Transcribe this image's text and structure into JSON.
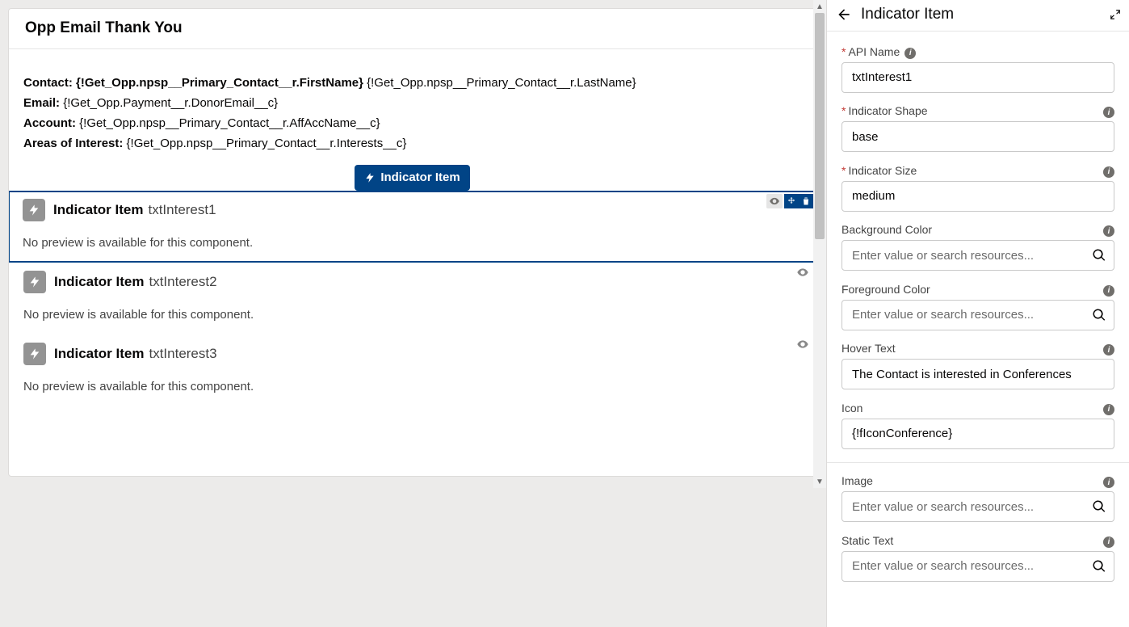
{
  "canvas": {
    "card_title": "Opp Email Thank You",
    "rows": [
      {
        "label": "Contact:",
        "value": "{!Get_Opp.npsp__Primary_Contact__r.FirstName} ",
        "value2": "{!Get_Opp.npsp__Primary_Contact__r.LastName}"
      },
      {
        "label": "Email:",
        "value": "{!Get_Opp.Payment__r.DonorEmail__c}"
      },
      {
        "label": "Account:",
        "value": "{!Get_Opp.npsp__Primary_Contact__r.AffAccName__c}"
      },
      {
        "label": "Areas of Interest:",
        "value": "{!Get_Opp.npsp__Primary_Contact__r.Interests__c}"
      }
    ],
    "badge_label": "Indicator Item",
    "indicators": [
      {
        "title": "Indicator Item",
        "sub": "txtInterest1",
        "msg": "No preview is available for this component.",
        "selected": true
      },
      {
        "title": "Indicator Item",
        "sub": "txtInterest2",
        "msg": "No preview is available for this component.",
        "selected": false
      },
      {
        "title": "Indicator Item",
        "sub": "txtInterest3",
        "msg": "No preview is available for this component.",
        "selected": false
      }
    ]
  },
  "panel": {
    "title": "Indicator Item",
    "fields": {
      "api_name": {
        "label": "API Name",
        "value": "txtInterest1",
        "required": true,
        "info_pos": "left"
      },
      "shape": {
        "label": "Indicator Shape",
        "value": "base",
        "required": true,
        "info_pos": "right"
      },
      "size": {
        "label": "Indicator Size",
        "value": "medium",
        "required": true,
        "info_pos": "right"
      },
      "bg": {
        "label": "Background Color",
        "placeholder": "Enter value or search resources...",
        "info_pos": "right",
        "search": true
      },
      "fg": {
        "label": "Foreground Color",
        "placeholder": "Enter value or search resources...",
        "info_pos": "right",
        "search": true
      },
      "hover": {
        "label": "Hover Text",
        "value": "The Contact is interested in Conferences",
        "info_pos": "right"
      },
      "icon": {
        "label": "Icon",
        "value": "{!fIconConference}",
        "info_pos": "right",
        "search": true
      },
      "image": {
        "label": "Image",
        "placeholder": "Enter value or search resources...",
        "info_pos": "right",
        "search": true
      },
      "static": {
        "label": "Static Text",
        "placeholder": "Enter value or search resources...",
        "info_pos": "right",
        "search": true
      }
    }
  }
}
